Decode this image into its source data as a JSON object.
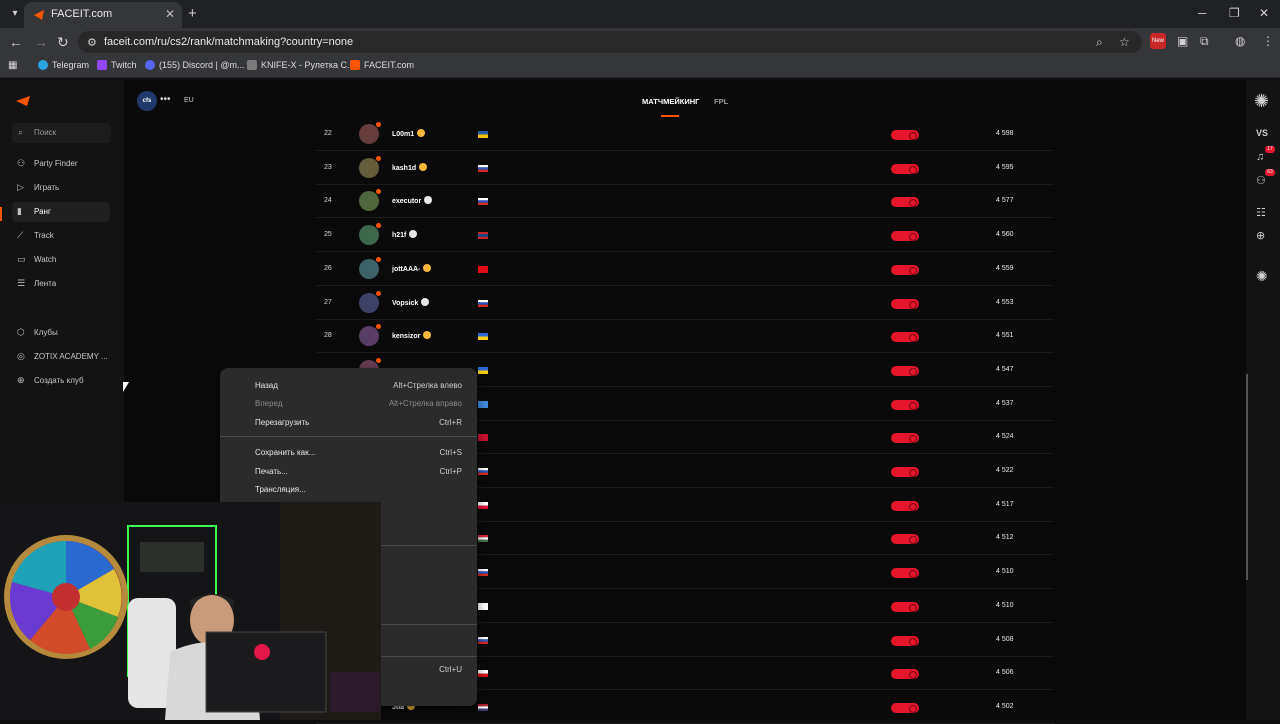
{
  "browser": {
    "tab": {
      "title": "FACEIT.com"
    },
    "url": "faceit.com/ru/cs2/rank/matchmaking?country=none",
    "new_badge": "New",
    "bookmarks": [
      {
        "label": "Telegram",
        "color": "#2aa3e0"
      },
      {
        "label": "Twitch",
        "color": "#9146ff"
      },
      {
        "label": "(155) Discord | @m...",
        "color": "#5865f2"
      },
      {
        "label": "KNIFE-X - Рулетка С...",
        "color": "#7a7a7a"
      },
      {
        "label": "FACEIT.com",
        "color": "#ff5500"
      }
    ]
  },
  "sidebar": {
    "search_placeholder": "Поиск",
    "items": [
      {
        "label": "Party Finder",
        "icon": "party-icon"
      },
      {
        "label": "Играть",
        "icon": "play-icon"
      },
      {
        "label": "Ранг",
        "icon": "rank-icon",
        "active": true
      },
      {
        "label": "Track",
        "icon": "track-icon"
      },
      {
        "label": "Watch",
        "icon": "watch-icon"
      },
      {
        "label": "Лента",
        "icon": "feed-icon"
      }
    ],
    "clubs": [
      {
        "label": "Клубы",
        "icon": "clubs-icon"
      },
      {
        "label": "ZOTIX ACADEMY ...",
        "icon": "club-icon"
      },
      {
        "label": "Создать клуб",
        "icon": "plus-icon"
      }
    ]
  },
  "header": {
    "game": "cfs",
    "region": "EU",
    "tabs": [
      "МАТЧМЕЙКИНГ",
      "FPL"
    ],
    "active_tab": "МАТЧМЕЙКИНГ"
  },
  "right_rail": {
    "label": "VS",
    "notifications": "17",
    "friends": "63"
  },
  "leaderboard": [
    {
      "rank": "22",
      "nick": "L00m1",
      "badge": "gold",
      "flag": "se",
      "elo": "4 598"
    },
    {
      "rank": "23",
      "nick": "kash1d",
      "badge": "gold",
      "flag": "ru",
      "elo": "4 595"
    },
    {
      "rank": "24",
      "nick": "executor",
      "badge": "white",
      "flag": "ru",
      "elo": "4 577"
    },
    {
      "rank": "25",
      "nick": "h21f",
      "badge": "white",
      "flag": "mn",
      "elo": "4 560"
    },
    {
      "rank": "26",
      "nick": "jottAAA-",
      "badge": "gold",
      "flag": "tr",
      "elo": "4 559"
    },
    {
      "rank": "27",
      "nick": "Vopsick",
      "badge": "white",
      "flag": "ru",
      "elo": "4 553"
    },
    {
      "rank": "28",
      "nick": "kensizor",
      "badge": "gold",
      "flag": "ua",
      "elo": "4 551"
    },
    {
      "rank": "",
      "nick": "",
      "badge": "",
      "flag": "ua",
      "elo": "4 547"
    },
    {
      "rank": "",
      "nick": "",
      "badge": "",
      "flag": "so",
      "elo": "4 537"
    },
    {
      "rank": "",
      "nick": "",
      "badge": "",
      "flag": "dk",
      "elo": "4 524"
    },
    {
      "rank": "",
      "nick": "",
      "badge": "",
      "flag": "ru",
      "elo": "4 522"
    },
    {
      "rank": "",
      "nick": "",
      "badge": "",
      "flag": "pl",
      "elo": "4 517"
    },
    {
      "rank": "",
      "nick": "",
      "badge": "",
      "flag": "hu",
      "elo": "4 512"
    },
    {
      "rank": "",
      "nick": "",
      "badge": "",
      "flag": "ru",
      "elo": "4 510"
    },
    {
      "rank": "",
      "nick": "",
      "badge": "",
      "flag": "il",
      "elo": "4 510"
    },
    {
      "rank": "",
      "nick": "",
      "badge": "",
      "flag": "ru",
      "elo": "4 508"
    },
    {
      "rank": "",
      "nick": "",
      "badge": "",
      "flag": "cz",
      "elo": "4 506"
    },
    {
      "rank": "",
      "nick": "Jtia",
      "badge": "gold",
      "flag": "us",
      "elo": "4 502"
    }
  ],
  "context_menu": {
    "items": [
      {
        "label": "Назад",
        "shortcut": "Alt+Стрелка влево",
        "disabled": false
      },
      {
        "label": "Вперед",
        "shortcut": "Alt+Стрелка вправо",
        "disabled": true
      },
      {
        "label": "Перезагрузить",
        "shortcut": "Ctrl+R",
        "disabled": false
      },
      {
        "label": "Сохранить как...",
        "shortcut": "Ctrl+S",
        "disabled": false
      },
      {
        "label": "Печать...",
        "shortcut": "Ctrl+P",
        "disabled": false
      },
      {
        "label": "Трансляция...",
        "shortcut": "",
        "disabled": false
      },
      {
        "label": "",
        "shortcut": "Ctrl+U",
        "disabled": false
      }
    ]
  },
  "colors": {
    "accent": "#ff5500",
    "level_badge": "#e5162b"
  }
}
